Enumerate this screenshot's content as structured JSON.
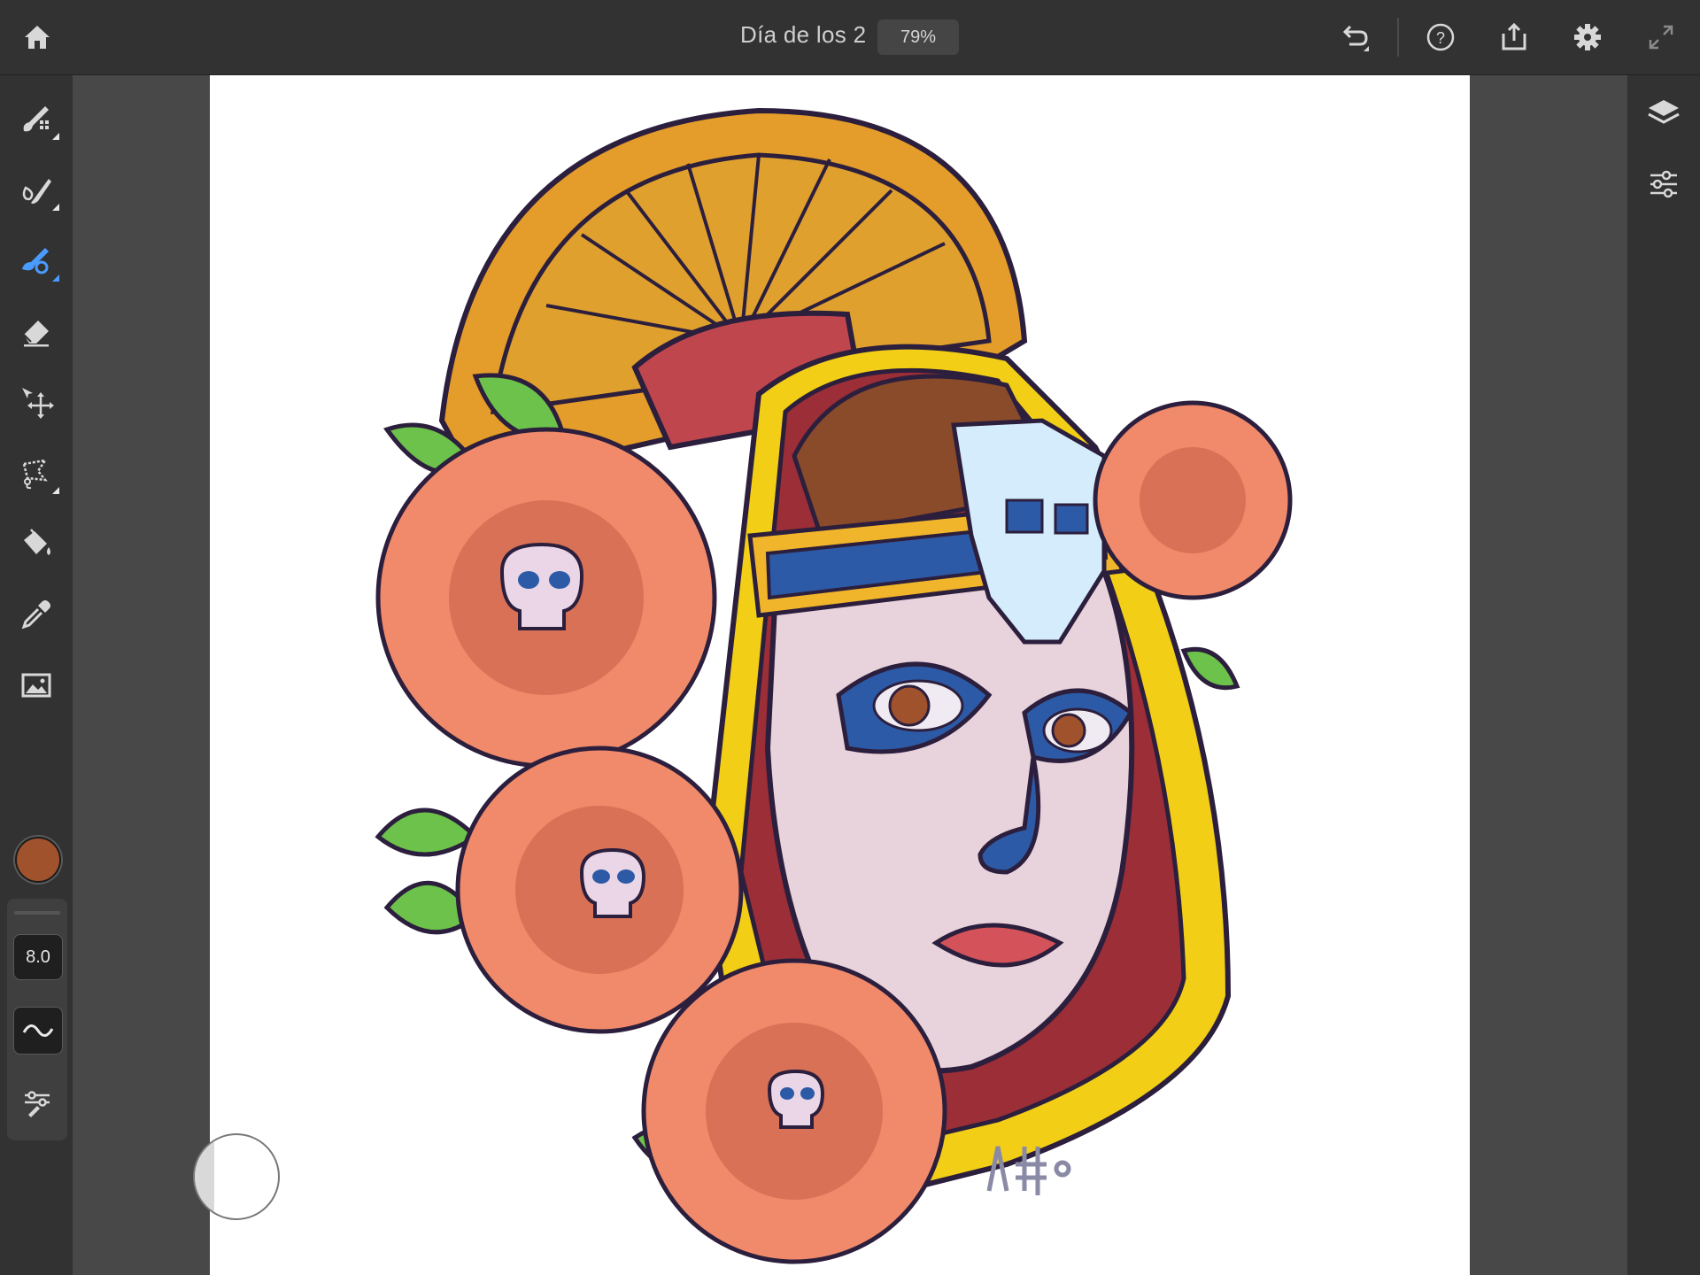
{
  "app": {
    "document_title": "Día de los 2",
    "zoom": "79%"
  },
  "toolbar": {
    "left": [
      {
        "icon": "home-icon"
      }
    ],
    "right": [
      {
        "icon": "undo-icon"
      },
      {
        "icon": "help-icon"
      },
      {
        "icon": "share-icon"
      },
      {
        "icon": "settings-icon"
      },
      {
        "icon": "fullscreen-icon"
      }
    ]
  },
  "tools": [
    {
      "icon": "pixel-brush-icon",
      "submenu": true
    },
    {
      "icon": "live-brush-icon",
      "submenu": true
    },
    {
      "icon": "vector-brush-icon",
      "submenu": true,
      "active": true,
      "active_color": "#4a9bff"
    },
    {
      "icon": "eraser-icon",
      "submenu": false
    },
    {
      "icon": "move-transform-icon",
      "submenu": false
    },
    {
      "icon": "lasso-select-icon",
      "submenu": true
    },
    {
      "icon": "fill-bucket-icon",
      "submenu": false
    },
    {
      "icon": "eyedropper-icon",
      "submenu": false
    },
    {
      "icon": "image-import-icon",
      "submenu": false
    }
  ],
  "brush": {
    "current_color": "#a0522d",
    "size": "8.0"
  },
  "right_panel": [
    {
      "icon": "layers-icon"
    },
    {
      "icon": "layer-properties-icon"
    }
  ],
  "colors": {
    "ui_dark": "#323232",
    "workspace": "#484848",
    "accent": "#4a9bff"
  }
}
